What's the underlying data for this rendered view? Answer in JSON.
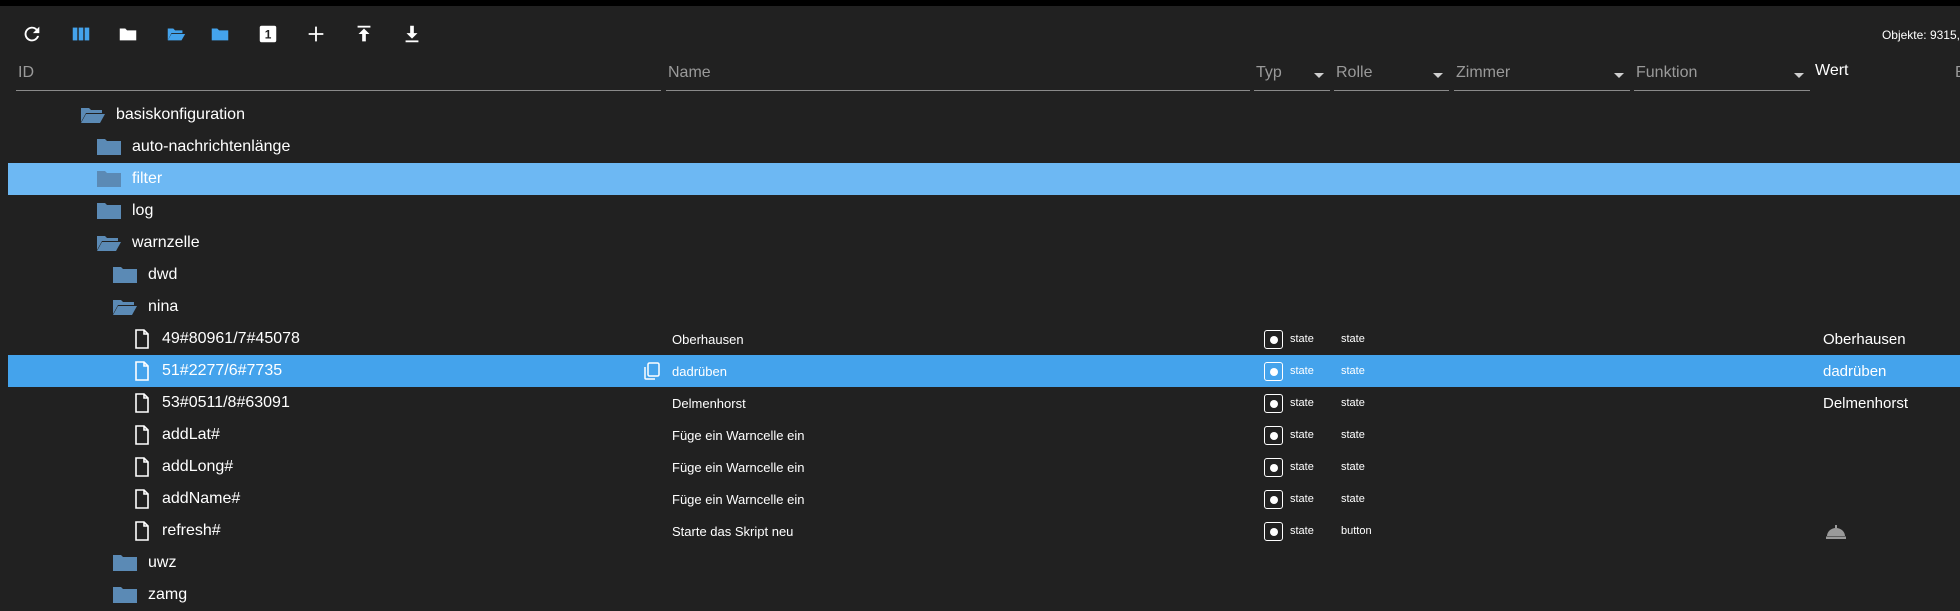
{
  "toolbar": {
    "buttons": [
      {
        "icon": "refresh-icon"
      },
      {
        "icon": "columns-icon"
      },
      {
        "icon": "folder-closed-icon"
      },
      {
        "icon": "folder-open-icon"
      },
      {
        "icon": "folder-blue-icon"
      },
      {
        "icon": "one-icon",
        "label": "1"
      },
      {
        "icon": "plus-icon"
      },
      {
        "icon": "upload-icon"
      },
      {
        "icon": "download-icon"
      }
    ],
    "object_count": "Objekte: 9315,"
  },
  "filters": {
    "id": "ID",
    "name": "Name",
    "typ": "Typ",
    "rolle": "Rolle",
    "zimmer": "Zimmer",
    "funktion": "Funktion",
    "wert": "Wert",
    "b": "B"
  },
  "colors": {
    "background": "#212121",
    "selected": "#44a3ec",
    "selected_light": "#6db8f3",
    "folder": "#5b8ab5"
  },
  "tree": [
    {
      "label": "basiskonfiguration",
      "kind": "folder-open",
      "level": 0
    },
    {
      "label": "auto-nachrichtenlänge",
      "kind": "folder",
      "level": 1
    },
    {
      "label": "filter",
      "kind": "folder",
      "level": 1,
      "selected": "light"
    },
    {
      "label": "log",
      "kind": "folder",
      "level": 1
    },
    {
      "label": "warnzelle",
      "kind": "folder-open",
      "level": 1
    },
    {
      "label": "dwd",
      "kind": "folder",
      "level": 2
    },
    {
      "label": "nina",
      "kind": "folder-open",
      "level": 2
    },
    {
      "label": "49#80961/7#45078",
      "kind": "state",
      "level": 3,
      "name": "Oberhausen",
      "typ": "state",
      "rolle": "state",
      "wert": "Oberhausen"
    },
    {
      "label": "51#2277/6#7735",
      "kind": "state",
      "level": 3,
      "name": "dadrüben",
      "typ": "state",
      "rolle": "state",
      "wert": "dadrüben",
      "selected": "full",
      "copy": true
    },
    {
      "label": "53#0511/8#63091",
      "kind": "state",
      "level": 3,
      "name": "Delmenhorst",
      "typ": "state",
      "rolle": "state",
      "wert": "Delmenhorst"
    },
    {
      "label": "addLat#",
      "kind": "state",
      "level": 3,
      "name": "Füge ein Warncelle ein",
      "typ": "state",
      "rolle": "state"
    },
    {
      "label": "addLong#",
      "kind": "state",
      "level": 3,
      "name": "Füge ein Warncelle ein",
      "typ": "state",
      "rolle": "state"
    },
    {
      "label": "addName#",
      "kind": "state",
      "level": 3,
      "name": "Füge ein Warncelle ein",
      "typ": "state",
      "rolle": "state"
    },
    {
      "label": "refresh#",
      "kind": "state",
      "level": 3,
      "name": "Starte das Skript neu",
      "typ": "state",
      "rolle": "button",
      "wert_icon": "bell-icon"
    },
    {
      "label": "uwz",
      "kind": "folder",
      "level": 2
    },
    {
      "label": "zamg",
      "kind": "folder",
      "level": 2
    }
  ]
}
